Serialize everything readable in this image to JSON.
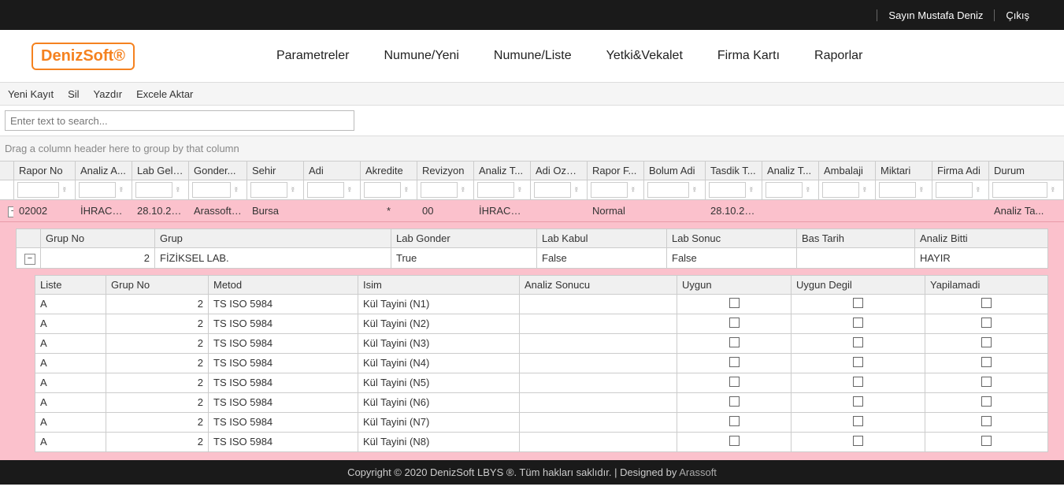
{
  "topbar": {
    "user": "Sayın Mustafa Deniz",
    "logout": "Çıkış"
  },
  "logo": "DenizSoft®",
  "mainnav": [
    "Parametreler",
    "Numune/Yeni",
    "Numune/Liste",
    "Yetki&Vekalet",
    "Firma Kartı",
    "Raporlar"
  ],
  "toolbar": [
    "Yeni Kayıt",
    "Sil",
    "Yazdır",
    "Excele Aktar"
  ],
  "search_placeholder": "Enter text to search...",
  "group_hint": "Drag a column header here to group by that column",
  "columns": [
    "Rapor No",
    "Analiz A...",
    "Lab Geli...",
    "Gonder...",
    "Sehir",
    "Adi",
    "Akredite",
    "Revizyon",
    "Analiz T...",
    "Adi Ozell...",
    "Rapor F...",
    "Bolum Adi",
    "Tasdik T...",
    "Analiz T...",
    "Ambalaji",
    "Miktari",
    "Firma Adi",
    "Durum"
  ],
  "row": {
    "rapor_no": "02002",
    "analiz_a": "İHRACAT...",
    "lab_geli": "28.10.20...",
    "gonder": "Arassoft ...",
    "sehir": "Bursa",
    "adi": "",
    "akredite": "*",
    "revizyon": "00",
    "analiz_t": "İHRACAT...",
    "adi_ozell": "",
    "rapor_f": "Normal",
    "bolum_adi": "",
    "tasdik_t": "28.10.20...",
    "analiz_t2": "",
    "ambalaji": "",
    "miktari": "",
    "firma_adi": "",
    "durum": "Analiz Ta..."
  },
  "sub_header": [
    "Grup No",
    "Grup",
    "Lab Gonder",
    "Lab Kabul",
    "Lab Sonuc",
    "Bas Tarih",
    "Analiz Bitti"
  ],
  "sub_row": {
    "grup_no": "2",
    "grup": "FİZİKSEL LAB.",
    "lab_gonder": "True",
    "lab_kabul": "False",
    "lab_sonuc": "False",
    "bas_tarih": "",
    "analiz_bitti": "HAYIR"
  },
  "inner_header": [
    "Liste",
    "Grup No",
    "Metod",
    "Isim",
    "Analiz Sonucu",
    "Uygun",
    "Uygun Degil",
    "Yapilamadi"
  ],
  "inner_rows": [
    {
      "liste": "A",
      "grup_no": "2",
      "metod": "TS ISO 5984",
      "isim": "Kül Tayini (N1)",
      "sonuc": ""
    },
    {
      "liste": "A",
      "grup_no": "2",
      "metod": "TS ISO 5984",
      "isim": "Kül Tayini (N2)",
      "sonuc": ""
    },
    {
      "liste": "A",
      "grup_no": "2",
      "metod": "TS ISO 5984",
      "isim": "Kül Tayini (N3)",
      "sonuc": ""
    },
    {
      "liste": "A",
      "grup_no": "2",
      "metod": "TS ISO 5984",
      "isim": "Kül Tayini (N4)",
      "sonuc": ""
    },
    {
      "liste": "A",
      "grup_no": "2",
      "metod": "TS ISO 5984",
      "isim": "Kül Tayini (N5)",
      "sonuc": ""
    },
    {
      "liste": "A",
      "grup_no": "2",
      "metod": "TS ISO 5984",
      "isim": "Kül Tayini (N6)",
      "sonuc": ""
    },
    {
      "liste": "A",
      "grup_no": "2",
      "metod": "TS ISO 5984",
      "isim": "Kül Tayini (N7)",
      "sonuc": ""
    },
    {
      "liste": "A",
      "grup_no": "2",
      "metod": "TS ISO 5984",
      "isim": "Kül Tayini (N8)",
      "sonuc": ""
    }
  ],
  "footer": {
    "text": "Copyright © 2020 DenizSoft LBYS ®. Tüm hakları saklıdır. | Designed by ",
    "link": "Arassoft"
  }
}
